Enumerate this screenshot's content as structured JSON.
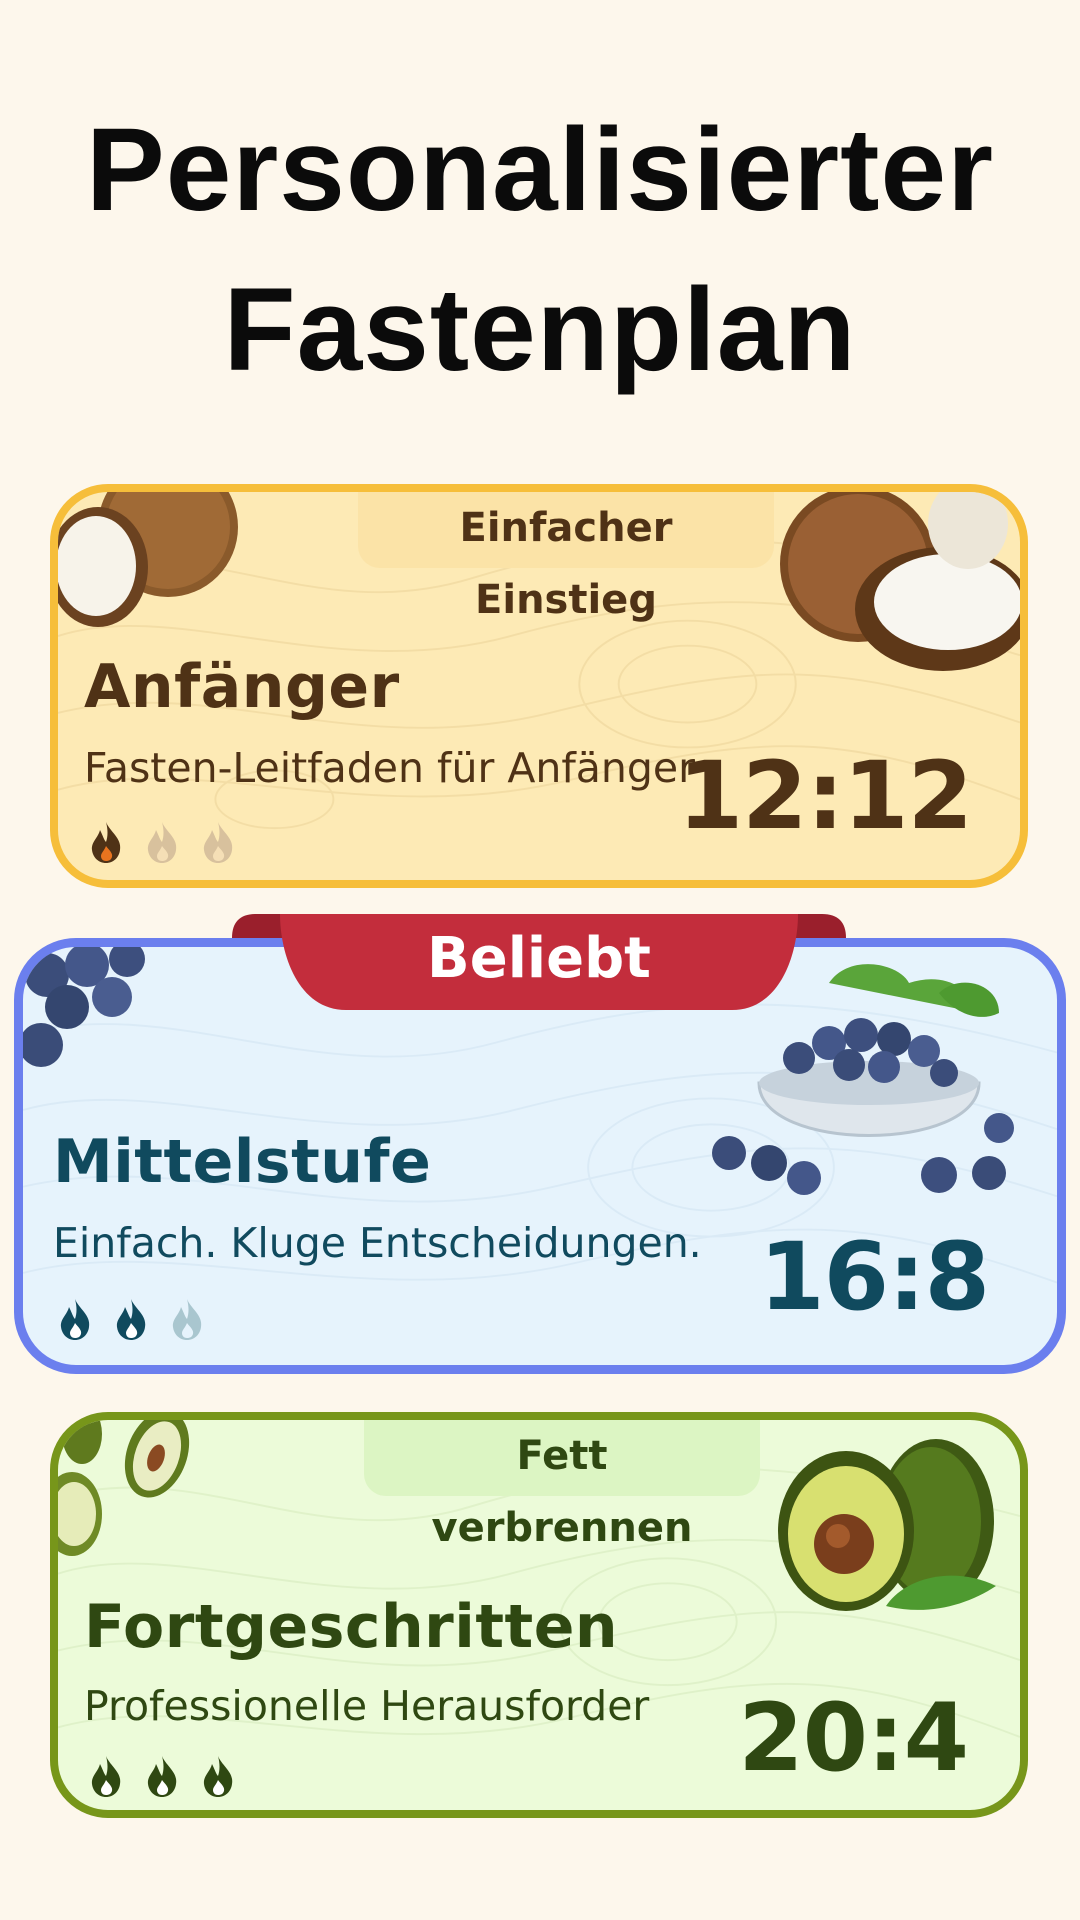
{
  "header": {
    "title_line1": "Personalisierter",
    "title_line2": "Fastenplan"
  },
  "plans": [
    {
      "tag": "Einfacher Einstieg",
      "level": "Anfänger",
      "subtitle": "Fasten-Leitfaden für Anfänger",
      "ratio": "12:12",
      "intensity": 1,
      "intensity_max": 3,
      "fruit_icon": "coconut-icon",
      "accent": "#f6be3a",
      "background": "#fdeab5",
      "text_color": "#4f3216"
    },
    {
      "badge": "Beliebt",
      "level": "Mittelstufe",
      "subtitle": "Einfach. Kluge Entscheidungen.",
      "ratio": "16:8",
      "intensity": 2,
      "intensity_max": 3,
      "fruit_icon": "blueberry-icon",
      "accent": "#6b7fee",
      "background": "#e6f3fc",
      "text_color": "#104a5e",
      "badge_color": "#c32d3c"
    },
    {
      "tag": "Fett verbrennen",
      "level": "Fortgeschritten",
      "subtitle": "Professionelle Herausforder",
      "ratio": "20:4",
      "intensity": 3,
      "intensity_max": 3,
      "fruit_icon": "avocado-icon",
      "accent": "#77961a",
      "background": "#ecfbd9",
      "text_color": "#2f4812"
    }
  ]
}
